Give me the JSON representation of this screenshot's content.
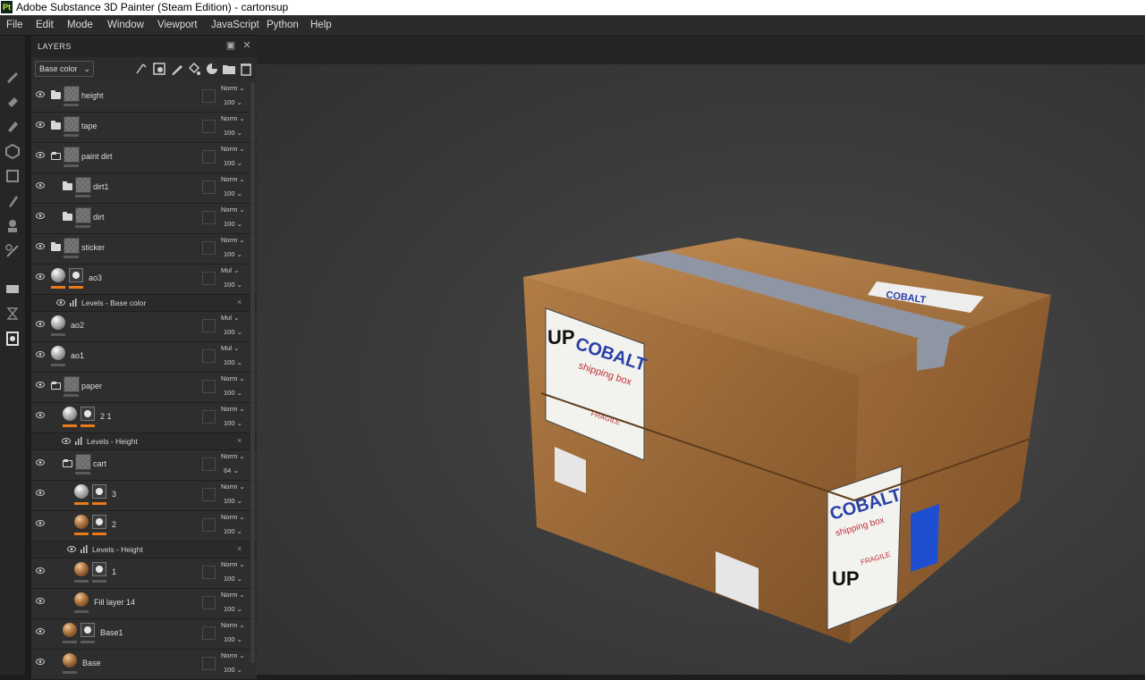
{
  "window": {
    "title": "Adobe Substance 3D Painter (Steam Edition) - cartonsup",
    "app_badge": "Pt"
  },
  "menu": [
    "File",
    "Edit",
    "Mode",
    "Window",
    "Viewport",
    "JavaScript",
    "Python",
    "Help"
  ],
  "layers_panel": {
    "title": "LAYERS",
    "channel": "Base color",
    "rows": [
      {
        "kind": "layer",
        "type": "folder",
        "name": "height",
        "blend": "Norm",
        "opacity": "100"
      },
      {
        "kind": "layer",
        "type": "folder",
        "name": "tape",
        "blend": "Norm",
        "opacity": "100"
      },
      {
        "kind": "layer",
        "type": "folder-open",
        "name": "paint dirt",
        "blend": "Norm",
        "opacity": "100"
      },
      {
        "kind": "layer",
        "type": "folder",
        "name": "dirt1",
        "blend": "Norm",
        "opacity": "100",
        "indent": 1
      },
      {
        "kind": "layer",
        "type": "folder",
        "name": "dirt",
        "blend": "Norm",
        "opacity": "100",
        "indent": 1
      },
      {
        "kind": "layer",
        "type": "folder",
        "name": "sticker",
        "blend": "Norm",
        "opacity": "100"
      },
      {
        "kind": "layer",
        "type": "fill-mask",
        "name": "ao3",
        "blend": "Mul",
        "opacity": "100",
        "bar": "orange"
      },
      {
        "kind": "effect",
        "name": "Levels - Base color",
        "indent": 1
      },
      {
        "kind": "layer",
        "type": "fill",
        "name": "ao2",
        "blend": "Mul",
        "opacity": "100"
      },
      {
        "kind": "layer",
        "type": "fill",
        "name": "ao1",
        "blend": "Mul",
        "opacity": "100"
      },
      {
        "kind": "layer",
        "type": "folder-open",
        "name": "paper",
        "blend": "Norm",
        "opacity": "100"
      },
      {
        "kind": "layer",
        "type": "fill-mask",
        "name": "2 1",
        "blend": "Norm",
        "opacity": "100",
        "indent": 1,
        "bar": "orange"
      },
      {
        "kind": "effect",
        "name": "Levels - Height",
        "indent": 2
      },
      {
        "kind": "layer",
        "type": "folder-open",
        "name": "cart",
        "blend": "Norm",
        "opacity": "64",
        "indent": 1
      },
      {
        "kind": "layer",
        "type": "fill-mask",
        "name": "3",
        "blend": "Norm",
        "opacity": "100",
        "indent": 2,
        "bar": "orange"
      },
      {
        "kind": "layer",
        "type": "fill-mask-brown",
        "name": "2",
        "blend": "Norm",
        "opacity": "100",
        "indent": 2,
        "bar": "orange"
      },
      {
        "kind": "effect",
        "name": "Levels - Height",
        "indent": 3
      },
      {
        "kind": "layer",
        "type": "fill-mask-brown",
        "name": "1",
        "blend": "Norm",
        "opacity": "100",
        "indent": 2
      },
      {
        "kind": "layer",
        "type": "fill-brown",
        "name": "Fill layer 14",
        "blend": "Norm",
        "opacity": "100",
        "indent": 2
      },
      {
        "kind": "layer",
        "type": "fill-mask-brown",
        "name": "Base1",
        "blend": "Norm",
        "opacity": "100",
        "indent": 1
      },
      {
        "kind": "layer",
        "type": "fill-brown",
        "name": "Base",
        "blend": "Norm",
        "opacity": "100",
        "indent": 1
      }
    ]
  },
  "viewport": {
    "sticker_front": {
      "top": "UP",
      "brand": "COBALT",
      "sub": "shipping box",
      "tag": "FRAGILE"
    },
    "sticker_side": {
      "brand": "COBALT",
      "sub": "shipping box",
      "top": "UP",
      "tag": "FRAGILE"
    },
    "sticker_lid": {
      "brand": "COBALT"
    }
  },
  "colors": {
    "accent": "#e87a1a",
    "panel": "#2c2c2c",
    "viewport": "#3c3c3c"
  }
}
